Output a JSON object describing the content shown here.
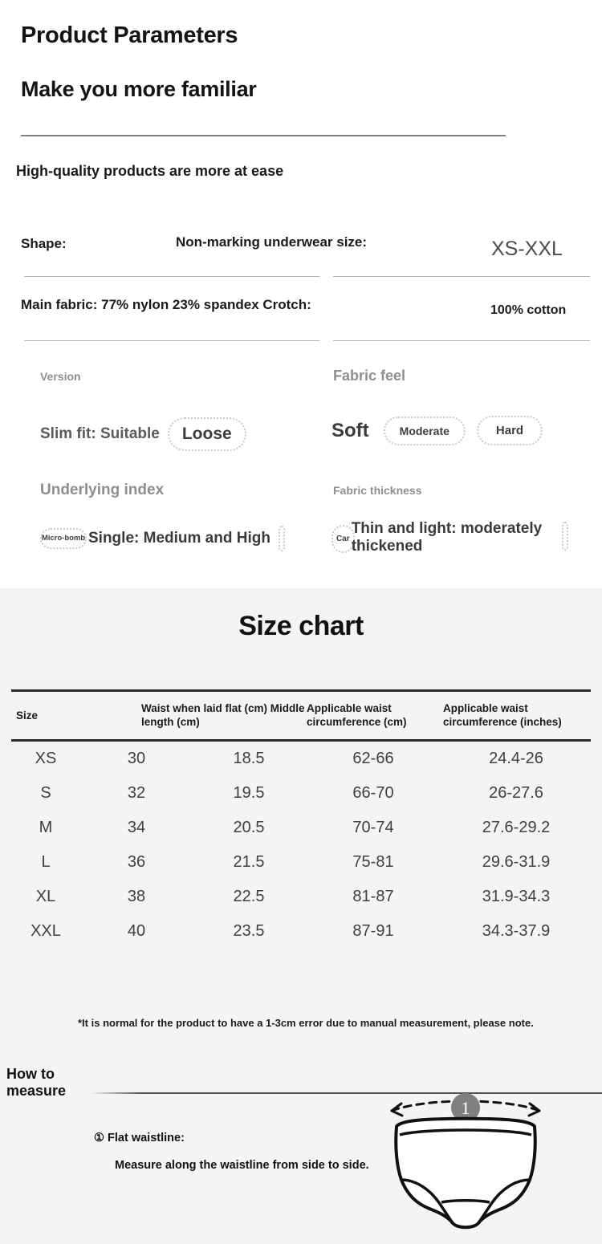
{
  "header": {
    "title": "Product Parameters",
    "subtitle": "Make you more familiar",
    "tagline": "High-quality products are more at ease"
  },
  "specs": [
    {
      "label": "Shape:",
      "label2": "Non-marking underwear size:",
      "value": "XS-XXL"
    },
    {
      "label": "Main fabric: 77% nylon 23% spandex Crotch:",
      "value": "100% cotton"
    }
  ],
  "options": [
    {
      "heading": "Version",
      "selected": "Slim fit: Suitable",
      "choices": [
        "Loose"
      ]
    },
    {
      "heading": "Fabric feel",
      "selected": "Soft",
      "choices": [
        "Moderate",
        "Hard"
      ]
    },
    {
      "heading": "Underlying index",
      "badge": "Micro-bomb",
      "selected": "Single: Medium and High",
      "choices": []
    },
    {
      "heading": "Fabric thickness",
      "badge": "Car",
      "selected": "Thin and light: moderately thickened",
      "choices": []
    }
  ],
  "size_chart": {
    "title": "Size chart",
    "columns": [
      "Size",
      "Waist when laid flat (cm) Middle length (cm)",
      "Applicable waist circumference (cm)",
      "Applicable waist circumference (inches)"
    ],
    "rows": [
      {
        "size": "XS",
        "waist_flat": "30",
        "middle_length": "18.5",
        "waist_cm": "62-66",
        "waist_in": "24.4-26"
      },
      {
        "size": "S",
        "waist_flat": "32",
        "middle_length": "19.5",
        "waist_cm": "66-70",
        "waist_in": "26-27.6"
      },
      {
        "size": "M",
        "waist_flat": "34",
        "middle_length": "20.5",
        "waist_cm": "70-74",
        "waist_in": "27.6-29.2"
      },
      {
        "size": "L",
        "waist_flat": "36",
        "middle_length": "21.5",
        "waist_cm": "75-81",
        "waist_in": "29.6-31.9"
      },
      {
        "size": "XL",
        "waist_flat": "38",
        "middle_length": "22.5",
        "waist_cm": "81-87",
        "waist_in": "31.9-34.3"
      },
      {
        "size": "XXL",
        "waist_flat": "40",
        "middle_length": "23.5",
        "waist_cm": "87-91",
        "waist_in": "34.3-37.9"
      }
    ],
    "note": "*It is normal for the product to have a 1-3cm error due to manual measurement, please note."
  },
  "how_to_measure": {
    "label": "How to measure",
    "step_title": "① Flat waistline:",
    "step_desc": "Measure along the waistline from side to side.",
    "diagram_badge": "1"
  },
  "colors": {
    "page_bg": "#ffffff",
    "chart_bg": "#f4f4f4",
    "text_dark": "#141414",
    "text_muted": "#8e8e8e",
    "rule": "#7b8288",
    "badge_gray": "#808080"
  }
}
